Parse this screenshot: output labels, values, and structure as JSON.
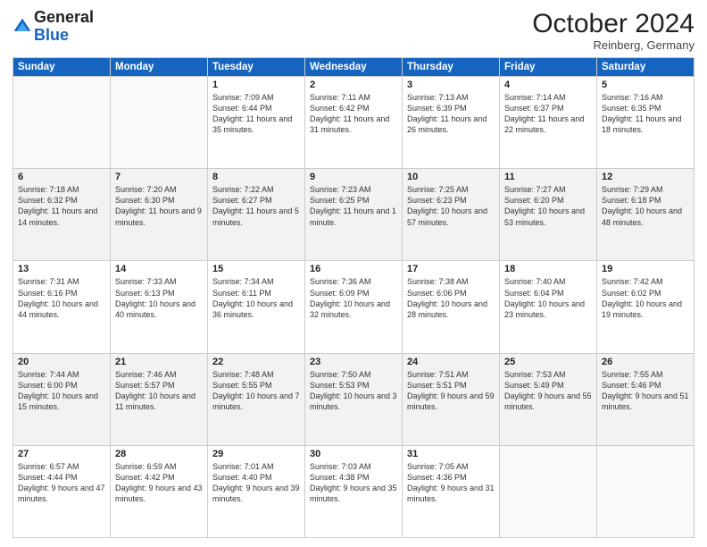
{
  "header": {
    "logo_line1": "General",
    "logo_line2": "Blue",
    "month": "October 2024",
    "location": "Reinberg, Germany"
  },
  "weekdays": [
    "Sunday",
    "Monday",
    "Tuesday",
    "Wednesday",
    "Thursday",
    "Friday",
    "Saturday"
  ],
  "rows": [
    {
      "stripe": "light",
      "days": [
        {
          "num": "",
          "empty": true
        },
        {
          "num": "",
          "empty": true
        },
        {
          "num": "1",
          "sunrise": "7:09 AM",
          "sunset": "6:44 PM",
          "daylight": "11 hours and 35 minutes."
        },
        {
          "num": "2",
          "sunrise": "7:11 AM",
          "sunset": "6:42 PM",
          "daylight": "11 hours and 31 minutes."
        },
        {
          "num": "3",
          "sunrise": "7:13 AM",
          "sunset": "6:39 PM",
          "daylight": "11 hours and 26 minutes."
        },
        {
          "num": "4",
          "sunrise": "7:14 AM",
          "sunset": "6:37 PM",
          "daylight": "11 hours and 22 minutes."
        },
        {
          "num": "5",
          "sunrise": "7:16 AM",
          "sunset": "6:35 PM",
          "daylight": "11 hours and 18 minutes."
        }
      ]
    },
    {
      "stripe": "dark",
      "days": [
        {
          "num": "6",
          "sunrise": "7:18 AM",
          "sunset": "6:32 PM",
          "daylight": "11 hours and 14 minutes."
        },
        {
          "num": "7",
          "sunrise": "7:20 AM",
          "sunset": "6:30 PM",
          "daylight": "11 hours and 9 minutes."
        },
        {
          "num": "8",
          "sunrise": "7:22 AM",
          "sunset": "6:27 PM",
          "daylight": "11 hours and 5 minutes."
        },
        {
          "num": "9",
          "sunrise": "7:23 AM",
          "sunset": "6:25 PM",
          "daylight": "11 hours and 1 minute."
        },
        {
          "num": "10",
          "sunrise": "7:25 AM",
          "sunset": "6:23 PM",
          "daylight": "10 hours and 57 minutes."
        },
        {
          "num": "11",
          "sunrise": "7:27 AM",
          "sunset": "6:20 PM",
          "daylight": "10 hours and 53 minutes."
        },
        {
          "num": "12",
          "sunrise": "7:29 AM",
          "sunset": "6:18 PM",
          "daylight": "10 hours and 48 minutes."
        }
      ]
    },
    {
      "stripe": "light",
      "days": [
        {
          "num": "13",
          "sunrise": "7:31 AM",
          "sunset": "6:16 PM",
          "daylight": "10 hours and 44 minutes."
        },
        {
          "num": "14",
          "sunrise": "7:33 AM",
          "sunset": "6:13 PM",
          "daylight": "10 hours and 40 minutes."
        },
        {
          "num": "15",
          "sunrise": "7:34 AM",
          "sunset": "6:11 PM",
          "daylight": "10 hours and 36 minutes."
        },
        {
          "num": "16",
          "sunrise": "7:36 AM",
          "sunset": "6:09 PM",
          "daylight": "10 hours and 32 minutes."
        },
        {
          "num": "17",
          "sunrise": "7:38 AM",
          "sunset": "6:06 PM",
          "daylight": "10 hours and 28 minutes."
        },
        {
          "num": "18",
          "sunrise": "7:40 AM",
          "sunset": "6:04 PM",
          "daylight": "10 hours and 23 minutes."
        },
        {
          "num": "19",
          "sunrise": "7:42 AM",
          "sunset": "6:02 PM",
          "daylight": "10 hours and 19 minutes."
        }
      ]
    },
    {
      "stripe": "dark",
      "days": [
        {
          "num": "20",
          "sunrise": "7:44 AM",
          "sunset": "6:00 PM",
          "daylight": "10 hours and 15 minutes."
        },
        {
          "num": "21",
          "sunrise": "7:46 AM",
          "sunset": "5:57 PM",
          "daylight": "10 hours and 11 minutes."
        },
        {
          "num": "22",
          "sunrise": "7:48 AM",
          "sunset": "5:55 PM",
          "daylight": "10 hours and 7 minutes."
        },
        {
          "num": "23",
          "sunrise": "7:50 AM",
          "sunset": "5:53 PM",
          "daylight": "10 hours and 3 minutes."
        },
        {
          "num": "24",
          "sunrise": "7:51 AM",
          "sunset": "5:51 PM",
          "daylight": "9 hours and 59 minutes."
        },
        {
          "num": "25",
          "sunrise": "7:53 AM",
          "sunset": "5:49 PM",
          "daylight": "9 hours and 55 minutes."
        },
        {
          "num": "26",
          "sunrise": "7:55 AM",
          "sunset": "5:46 PM",
          "daylight": "9 hours and 51 minutes."
        }
      ]
    },
    {
      "stripe": "light",
      "days": [
        {
          "num": "27",
          "sunrise": "6:57 AM",
          "sunset": "4:44 PM",
          "daylight": "9 hours and 47 minutes."
        },
        {
          "num": "28",
          "sunrise": "6:59 AM",
          "sunset": "4:42 PM",
          "daylight": "9 hours and 43 minutes."
        },
        {
          "num": "29",
          "sunrise": "7:01 AM",
          "sunset": "4:40 PM",
          "daylight": "9 hours and 39 minutes."
        },
        {
          "num": "30",
          "sunrise": "7:03 AM",
          "sunset": "4:38 PM",
          "daylight": "9 hours and 35 minutes."
        },
        {
          "num": "31",
          "sunrise": "7:05 AM",
          "sunset": "4:36 PM",
          "daylight": "9 hours and 31 minutes."
        },
        {
          "num": "",
          "empty": true
        },
        {
          "num": "",
          "empty": true
        }
      ]
    }
  ],
  "labels": {
    "sunrise": "Sunrise:",
    "sunset": "Sunset:",
    "daylight": "Daylight:"
  }
}
